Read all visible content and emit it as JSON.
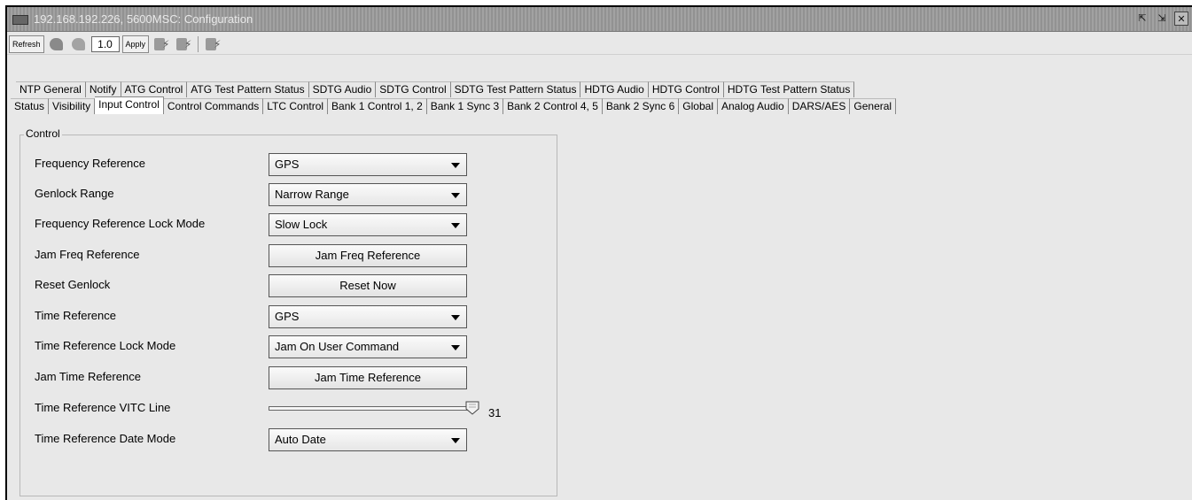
{
  "window": {
    "title": "192.168.192.226, 5600MSC: Configuration",
    "icons": [
      "monitor-icon",
      "detach-icon",
      "dock-icon",
      "close-icon"
    ]
  },
  "toolbar": {
    "refresh_label": "Refresh",
    "value": "1.0",
    "apply_label": "Apply"
  },
  "tabs_row1": [
    "NTP General",
    "Notify",
    "ATG Control",
    "ATG Test Pattern Status",
    "SDTG Audio",
    "SDTG Control",
    "SDTG Test Pattern Status",
    "HDTG Audio",
    "HDTG Control",
    "HDTG Test Pattern Status"
  ],
  "tabs_row2": [
    "Status",
    "Visibility",
    "Input Control",
    "Control Commands",
    "LTC Control",
    "Bank 1 Control 1, 2",
    "Bank 1 Sync 3",
    "Bank 2 Control 4, 5",
    "Bank 2 Sync 6",
    "Global",
    "Analog Audio",
    "DARS/AES",
    "General"
  ],
  "active_tab": "Input Control",
  "panel": {
    "title": "Control",
    "rows": {
      "freq_ref": {
        "label": "Frequency Reference",
        "value": "GPS"
      },
      "genlock_range": {
        "label": "Genlock Range",
        "value": "Narrow Range"
      },
      "freq_lock_mode": {
        "label": "Frequency Reference Lock Mode",
        "value": "Slow Lock"
      },
      "jam_freq": {
        "label": "Jam Freq Reference",
        "button": "Jam Freq Reference"
      },
      "reset_genlock": {
        "label": "Reset Genlock",
        "button": "Reset Now"
      },
      "time_ref": {
        "label": "Time Reference",
        "value": "GPS"
      },
      "time_lock_mode": {
        "label": "Time Reference Lock Mode",
        "value": "Jam On User Command"
      },
      "jam_time": {
        "label": "Jam Time Reference",
        "button": "Jam Time Reference"
      },
      "vitc_line": {
        "label": "Time Reference VITC Line",
        "value": "31",
        "fraction": 1.0
      },
      "date_mode": {
        "label": "Time Reference Date Mode",
        "value": "Auto Date"
      }
    }
  }
}
